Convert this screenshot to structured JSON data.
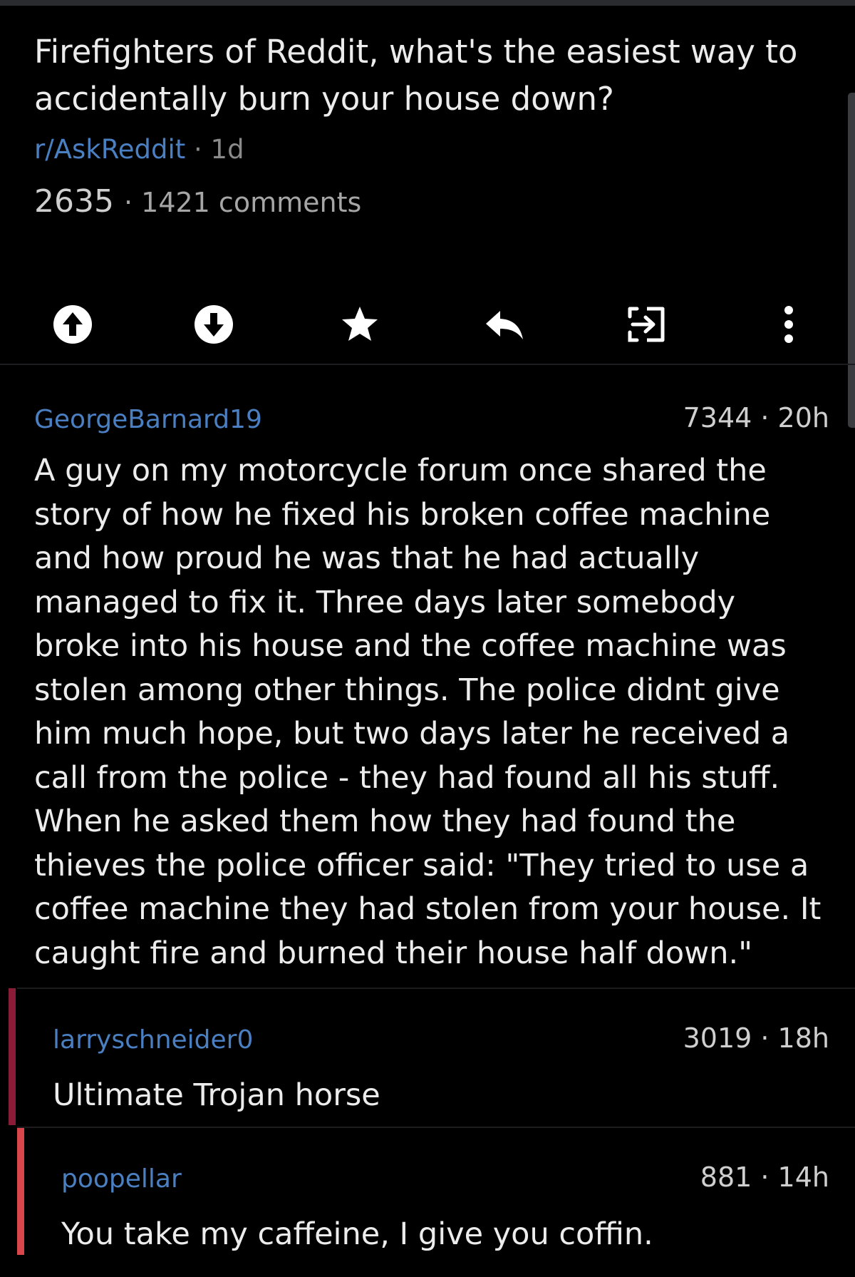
{
  "post": {
    "title": "Firefighters of Reddit, what's the easiest way to accidentally burn your house down?",
    "subreddit": "r/AskReddit",
    "age": "· 1d",
    "score": "2635",
    "comments": "· 1421 comments"
  },
  "actions": [
    {
      "icon": "upvote-icon"
    },
    {
      "icon": "downvote-icon"
    },
    {
      "icon": "star-icon"
    },
    {
      "icon": "reply-icon"
    },
    {
      "icon": "share-icon"
    },
    {
      "icon": "more-icon"
    }
  ],
  "comments": [
    {
      "author": "GeorgeBarnard19",
      "meta": "7344 · 20h",
      "body": "A guy on my motorcycle forum once shared the story of how he fixed his broken coffee machine and how proud he was that he had actually managed to fix it. Three days later somebody broke into his house and the coffee machine was stolen among other things. The police didnt give him much hope, but two days later he received a call from the police - they had found all his stuff. When he asked them how they had found the thieves the police officer said: \"They tried to use a coffee machine they had stolen from your house. It caught fire and burned their house half down.\""
    },
    {
      "author": "larryschneider0",
      "meta": "3019 · 18h",
      "body": "Ultimate Trojan horse"
    },
    {
      "author": "poopellar",
      "meta": "881 · 14h",
      "body": "You take my caffeine, I give you coffin."
    }
  ],
  "colors": {
    "background": "#000000",
    "link": "#4a7fc1",
    "depth_1": "#8a1c38",
    "depth_2": "#d8454a"
  }
}
